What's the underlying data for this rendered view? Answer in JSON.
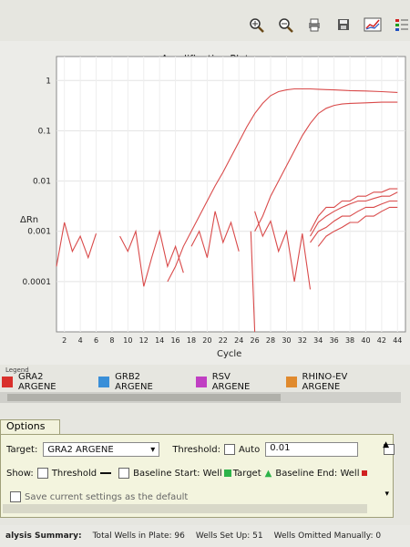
{
  "toolbar": {
    "icons": [
      "zoom-in-icon",
      "zoom-out-icon",
      "print-icon",
      "save-icon",
      "chart-view-icon",
      "legend-icon"
    ]
  },
  "plot": {
    "title": "Amplification Plot",
    "xlabel": "Cycle",
    "ylabel": "ΔRn"
  },
  "chart_data": {
    "type": "line",
    "title": "Amplification Plot",
    "xlabel": "Cycle",
    "ylabel": "ΔRn",
    "xlim": [
      1,
      45
    ],
    "ylim": [
      1e-05,
      3
    ],
    "yscale": "log",
    "x_ticks": [
      "2",
      "4",
      "6",
      "8",
      "10",
      "12",
      "14",
      "16",
      "18",
      "20",
      "22",
      "24",
      "26",
      "28",
      "30",
      "32",
      "34",
      "36",
      "38",
      "40",
      "42",
      "44"
    ],
    "y_ticks": [
      "1",
      "0.1",
      "0.01",
      "0.001",
      "0.0001"
    ],
    "series": [
      {
        "color": "#d94a4a",
        "x": [
          15,
          16,
          17,
          18,
          19,
          20,
          21,
          22,
          23,
          24,
          25,
          26,
          27,
          28,
          29,
          30,
          31,
          32,
          33,
          34,
          35,
          36,
          38,
          40,
          42,
          44
        ],
        "values": [
          0.0001,
          0.0002,
          0.0005,
          0.001,
          0.002,
          0.004,
          0.008,
          0.015,
          0.03,
          0.06,
          0.12,
          0.22,
          0.35,
          0.5,
          0.6,
          0.65,
          0.68,
          0.68,
          0.68,
          0.67,
          0.66,
          0.65,
          0.63,
          0.62,
          0.6,
          0.58
        ]
      },
      {
        "color": "#d94a4a",
        "x": [
          26,
          27,
          28,
          29,
          30,
          31,
          32,
          33,
          34,
          35,
          36,
          37,
          38,
          40,
          42,
          44
        ],
        "values": [
          0.001,
          0.002,
          0.005,
          0.01,
          0.02,
          0.04,
          0.08,
          0.14,
          0.22,
          0.28,
          0.32,
          0.34,
          0.35,
          0.36,
          0.37,
          0.37
        ]
      },
      {
        "color": "#d94a4a",
        "x": [
          33,
          34,
          35,
          36,
          37,
          38,
          39,
          40,
          41,
          42,
          43,
          44
        ],
        "values": [
          0.001,
          0.002,
          0.003,
          0.003,
          0.004,
          0.004,
          0.005,
          0.005,
          0.006,
          0.006,
          0.007,
          0.007
        ]
      },
      {
        "color": "#d94a4a",
        "x": [
          33,
          34,
          35,
          36,
          37,
          38,
          39,
          40,
          41,
          42,
          43,
          44
        ],
        "values": [
          0.0008,
          0.0015,
          0.002,
          0.0025,
          0.003,
          0.0035,
          0.004,
          0.004,
          0.0045,
          0.005,
          0.005,
          0.006
        ]
      },
      {
        "color": "#d94a4a",
        "x": [
          33,
          34,
          35,
          36,
          37,
          38,
          39,
          40,
          41,
          42,
          43,
          44
        ],
        "values": [
          0.0006,
          0.001,
          0.0012,
          0.0016,
          0.002,
          0.002,
          0.0025,
          0.003,
          0.003,
          0.0035,
          0.004,
          0.004
        ]
      },
      {
        "color": "#d94a4a",
        "x": [
          34,
          35,
          36,
          37,
          38,
          39,
          40,
          41,
          42,
          43,
          44
        ],
        "values": [
          0.0005,
          0.0008,
          0.001,
          0.0012,
          0.0015,
          0.0015,
          0.002,
          0.002,
          0.0025,
          0.003,
          0.003
        ]
      },
      {
        "color": "#d94a4a",
        "x": [
          1,
          2,
          3,
          4,
          5,
          6
        ],
        "values": [
          0.0002,
          0.0015,
          0.0004,
          0.0008,
          0.0003,
          0.0009
        ]
      },
      {
        "color": "#d94a4a",
        "x": [
          9,
          10,
          11,
          12,
          13,
          14,
          15,
          16,
          17
        ],
        "values": [
          0.0008,
          0.0004,
          0.001,
          8e-05,
          0.0003,
          0.001,
          0.0002,
          0.0005,
          0.00015
        ]
      },
      {
        "color": "#d94a4a",
        "x": [
          18,
          19,
          20,
          21,
          22,
          23,
          24
        ],
        "values": [
          0.0005,
          0.001,
          0.0003,
          0.0025,
          0.0006,
          0.0015,
          0.0004
        ]
      },
      {
        "color": "#d94a4a",
        "x": [
          26,
          27,
          28,
          29,
          30,
          31,
          32,
          33
        ],
        "values": [
          0.0025,
          0.0008,
          0.0016,
          0.0004,
          0.001,
          0.0001,
          0.0009,
          7e-05
        ]
      },
      {
        "color": "#d94a4a",
        "x": [
          25.5,
          26
        ],
        "values": [
          0.001,
          1e-05
        ]
      }
    ]
  },
  "legend": {
    "title": "Legend",
    "items": [
      {
        "label": "GRA2 ARGENE",
        "color": "#d9302c"
      },
      {
        "label": "GRB2 ARGENE",
        "color": "#3a8fd8"
      },
      {
        "label": "RSV ARGENE",
        "color": "#c03fc3"
      },
      {
        "label": "RHINO-EV ARGENE",
        "color": "#e08a2e"
      }
    ]
  },
  "options": {
    "tab_label": "Options",
    "target_label": "Target:",
    "target_value": "GRA2 ARGENE",
    "threshold_label": "Threshold:",
    "auto_label": "Auto",
    "threshold_value": "0.01",
    "show_label": "Show:",
    "show_threshold": "Threshold",
    "baseline_start": "Baseline Start: Well",
    "target_marker": "Target",
    "baseline_end": "Baseline End: Well",
    "save_default": "Save current settings as the default"
  },
  "status": {
    "summary_label": "alysis Summary:",
    "total_wells": "Total Wells in Plate: 96",
    "wells_setup": "Wells Set Up: 51",
    "wells_omitted": "Wells Omitted Manually: 0"
  }
}
